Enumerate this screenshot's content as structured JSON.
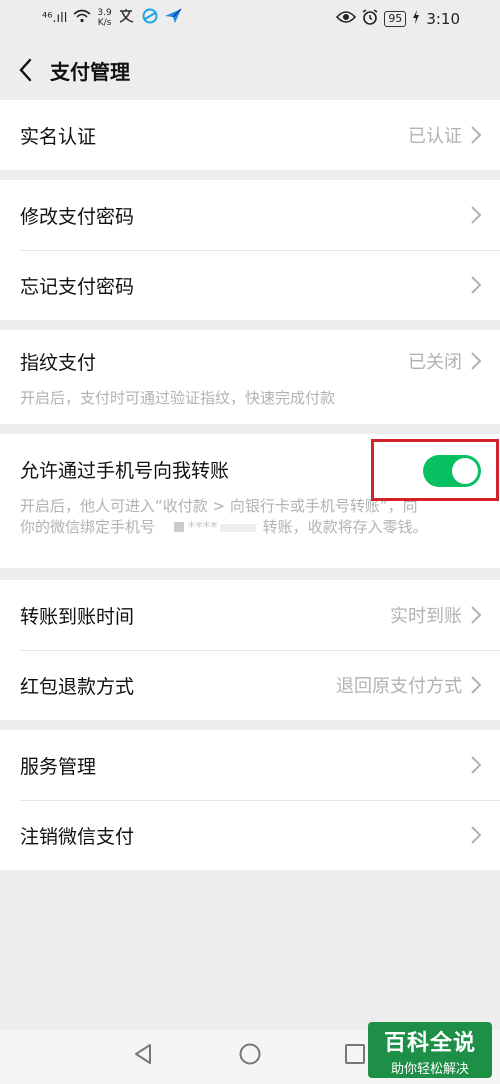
{
  "status_bar": {
    "network": "⁴⁶.ıll",
    "speed_value": "3.9",
    "speed_unit": "K/s",
    "battery": "95",
    "time": "3:10"
  },
  "header": {
    "title": "支付管理"
  },
  "groups": {
    "realname": {
      "label": "实名认证",
      "value": "已认证"
    },
    "modify_pwd": {
      "label": "修改支付密码"
    },
    "forgot_pwd": {
      "label": "忘记支付密码"
    },
    "fingerprint": {
      "label": "指纹支付",
      "value": "已关闭",
      "desc": "开启后，支付时可通过验证指纹，快速完成付款"
    },
    "phone_transfer": {
      "label": "允许通过手机号向我转账",
      "enabled": true,
      "desc_line1": "开启后，他人可进入“收付款 > 向银行卡或手机号转账”，向",
      "desc_line2_start": "你的微信绑定手机号",
      "masked": "****",
      "desc_line2_end": "转账，收款将存入零钱。"
    },
    "arrival_time": {
      "label": "转账到账时间",
      "value": "实时到账"
    },
    "refund_method": {
      "label": "红包退款方式",
      "value": "退回原支付方式"
    },
    "service_mgmt": {
      "label": "服务管理"
    },
    "cancel_pay": {
      "label": "注销微信支付"
    }
  },
  "watermark": {
    "title": "百科全说",
    "subtitle": "助你轻松解决"
  },
  "colors": {
    "toggle_on": "#07c160",
    "highlight": "#d4222a",
    "watermark_bg": "#1d8f46"
  }
}
